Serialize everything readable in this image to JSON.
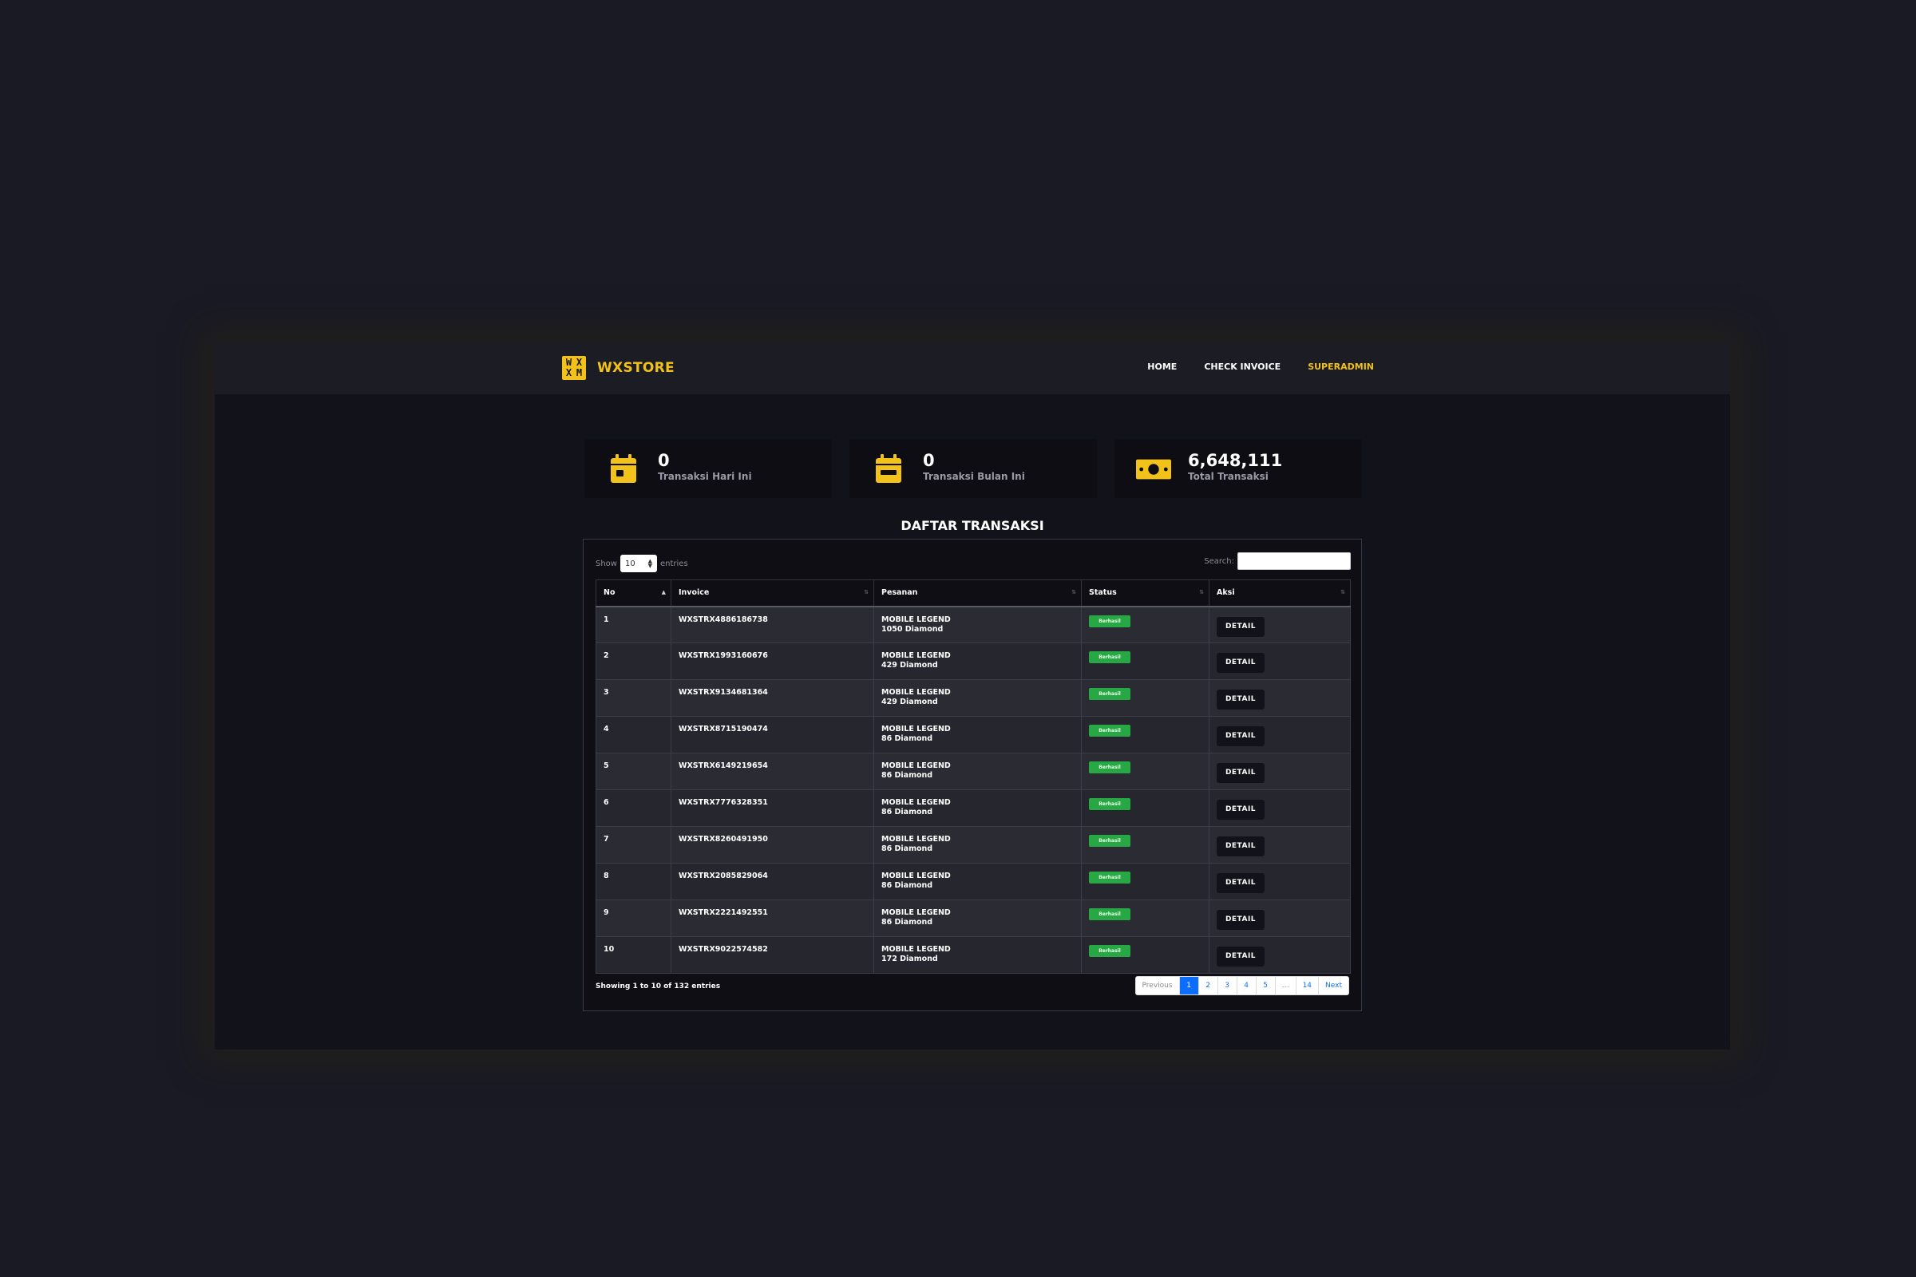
{
  "brand": {
    "logo_letters": [
      "W",
      "X",
      "X",
      "M"
    ],
    "name": "WXSTORE"
  },
  "nav": {
    "home": "HOME",
    "check_invoice": "CHECK INVOICE",
    "superadmin": "SUPERADMIN"
  },
  "stats": [
    {
      "icon": "calendar-day-icon",
      "value": "0",
      "label": "Transaksi Hari Ini"
    },
    {
      "icon": "calendar-month-icon",
      "value": "0",
      "label": "Transaksi Bulan Ini"
    },
    {
      "icon": "money-bill-icon",
      "value": "6,648,111",
      "label": "Total Transaksi"
    }
  ],
  "section_title": "DAFTAR TRANSAKSI",
  "controls": {
    "show_label": "Show",
    "entries_value": "10",
    "entries_label": "entries",
    "search_label": "Search:"
  },
  "table": {
    "headers": [
      "No",
      "Invoice",
      "Pesanan",
      "Status",
      "Aksi"
    ],
    "rows": [
      {
        "no": "1",
        "invoice": "WXSTRX4886186738",
        "game": "MOBILE LEGEND",
        "item": "1050 Diamond",
        "status": "Berhasil",
        "action": "DETAIL"
      },
      {
        "no": "2",
        "invoice": "WXSTRX1993160676",
        "game": "MOBILE LEGEND",
        "item": "429 Diamond",
        "status": "Berhasil",
        "action": "DETAIL"
      },
      {
        "no": "3",
        "invoice": "WXSTRX9134681364",
        "game": "MOBILE LEGEND",
        "item": "429 Diamond",
        "status": "Berhasil",
        "action": "DETAIL"
      },
      {
        "no": "4",
        "invoice": "WXSTRX8715190474",
        "game": "MOBILE LEGEND",
        "item": "86 Diamond",
        "status": "Berhasil",
        "action": "DETAIL"
      },
      {
        "no": "5",
        "invoice": "WXSTRX6149219654",
        "game": "MOBILE LEGEND",
        "item": "86 Diamond",
        "status": "Berhasil",
        "action": "DETAIL"
      },
      {
        "no": "6",
        "invoice": "WXSTRX7776328351",
        "game": "MOBILE LEGEND",
        "item": "86 Diamond",
        "status": "Berhasil",
        "action": "DETAIL"
      },
      {
        "no": "7",
        "invoice": "WXSTRX8260491950",
        "game": "MOBILE LEGEND",
        "item": "86 Diamond",
        "status": "Berhasil",
        "action": "DETAIL"
      },
      {
        "no": "8",
        "invoice": "WXSTRX2085829064",
        "game": "MOBILE LEGEND",
        "item": "86 Diamond",
        "status": "Berhasil",
        "action": "DETAIL"
      },
      {
        "no": "9",
        "invoice": "WXSTRX2221492551",
        "game": "MOBILE LEGEND",
        "item": "86 Diamond",
        "status": "Berhasil",
        "action": "DETAIL"
      },
      {
        "no": "10",
        "invoice": "WXSTRX9022574582",
        "game": "MOBILE LEGEND",
        "item": "172 Diamond",
        "status": "Berhasil",
        "action": "DETAIL"
      }
    ]
  },
  "footer": {
    "info": "Showing 1 to 10 of 132 entries"
  },
  "pagination": [
    "Previous",
    "1",
    "2",
    "3",
    "4",
    "5",
    "…",
    "14",
    "Next"
  ],
  "colors": {
    "accent": "#f2c21a",
    "success": "#28a745",
    "page_active": "#0d6efd",
    "background": "#1a1a24"
  }
}
